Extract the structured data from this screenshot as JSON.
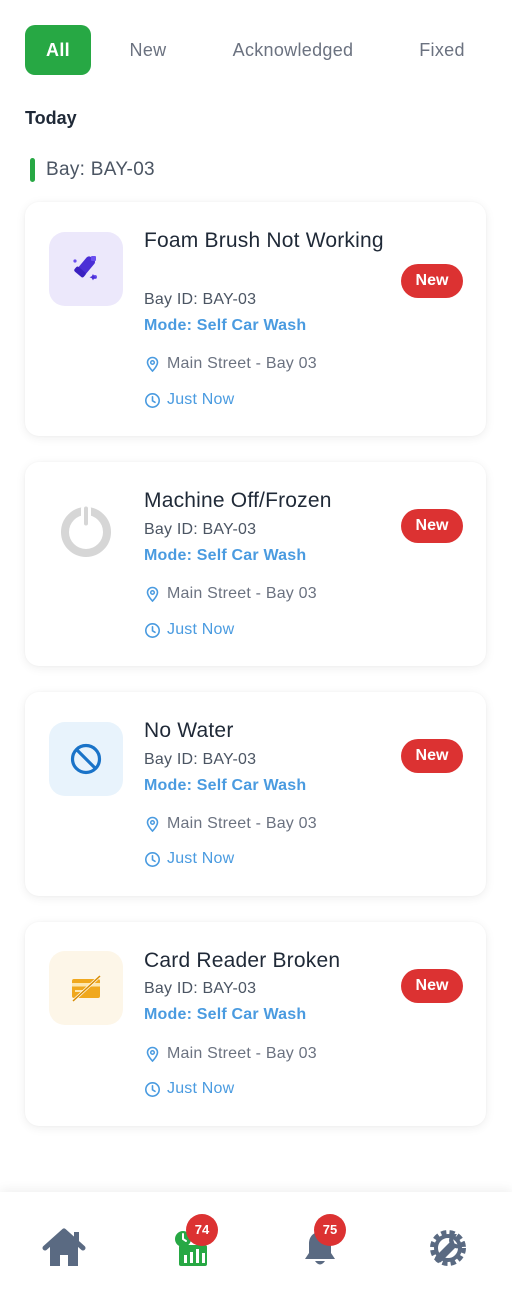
{
  "tabs": [
    {
      "label": "All",
      "active": true
    },
    {
      "label": "New",
      "active": false
    },
    {
      "label": "Acknowledged",
      "active": false
    },
    {
      "label": "Fixed",
      "active": false
    }
  ],
  "section": {
    "day": "Today",
    "bay_label": "Bay: BAY-03"
  },
  "alerts": [
    {
      "title": "Foam Brush Not Working",
      "bay_id": "Bay ID: BAY-03",
      "mode": "Mode: Self Car Wash",
      "location": "Main Street - Bay 03",
      "time": "Just Now",
      "status": "New",
      "icon": "foam-brush-icon"
    },
    {
      "title": "Machine Off/Frozen",
      "bay_id": "Bay ID: BAY-03",
      "mode": "Mode: Self Car Wash",
      "location": "Main Street - Bay 03",
      "time": "Just Now",
      "status": "New",
      "icon": "power-icon"
    },
    {
      "title": "No Water",
      "bay_id": "Bay ID: BAY-03",
      "mode": "Mode: Self Car Wash",
      "location": "Main Street - Bay 03",
      "time": "Just Now",
      "status": "New",
      "icon": "no-water-icon"
    },
    {
      "title": "Card Reader Broken",
      "bay_id": "Bay ID: BAY-03",
      "mode": "Mode: Self Car Wash",
      "location": "Main Street - Bay 03",
      "time": "Just Now",
      "status": "New",
      "icon": "card-broken-icon"
    }
  ],
  "nav": {
    "home_icon": "home-icon",
    "reports_icon": "reports-icon",
    "reports_badge": "74",
    "notifications_icon": "bell-icon",
    "notifications_badge": "75",
    "settings_icon": "wrench-gear-icon"
  },
  "colors": {
    "accent_green": "#27a844",
    "badge_red": "#dc3232",
    "link_blue": "#4a9be0",
    "nav_icon": "#5a6a82"
  }
}
